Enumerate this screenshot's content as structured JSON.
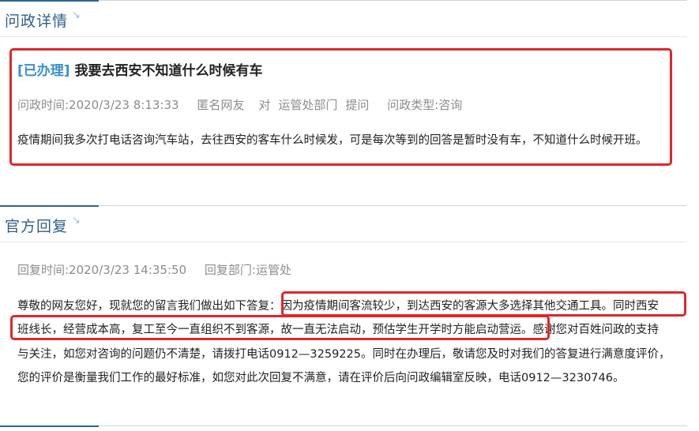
{
  "inquiry_section": {
    "title": "问政详情",
    "status": "[已办理]",
    "subject": "我要去西安不知道什么时候有车",
    "time": "问政时间:2020/3/23 8:13:33",
    "asker": "匿名网友",
    "to": "对",
    "department": "运管处部门",
    "action": "提问",
    "type": "问政类型:咨询",
    "content": "疫情期间我多次打电话咨询汽车站，去往西安的客车什么时候发，可是每次等到的回答是暂时没有车，不知道什么时候开班。"
  },
  "reply_section": {
    "title": "官方回复",
    "time": "回复时间:2020/3/23 14:35:50",
    "department": "回复部门:运管处",
    "line1_prefix": "尊敬的网友您好，现就您的留言我们做出如下答复：",
    "line1_highlight": "因为疫情期间客流较少，到达西安的客源大多选择其他交通工具。同时西安",
    "line2_highlight": "班线长，经营成本高，复工至今一直组织不到客源，故一直无法启动，预估学生开学时方能启动营运。",
    "line2_suffix": "感谢您对百姓问政的支持",
    "line3": "与关注，如您对咨询的问题仍不清楚，请拨打电话0912—3259225。同时在办理后，敬请您及时对我们的答复进行满意度评价，",
    "line4": "您的评价是衡量我们工作的最好标准，如您对此次回复不满意，请在评价后向问政编辑室反映，电话0912—3230746。"
  },
  "colors": {
    "accent": "#2a6496",
    "section_title": "#2f5f8a",
    "status": "#3a8fd0",
    "highlight_border": "#e0252b",
    "meta_text": "#8c8c8c"
  },
  "icons": {
    "section_arrow": "corner-arrow-icon"
  }
}
